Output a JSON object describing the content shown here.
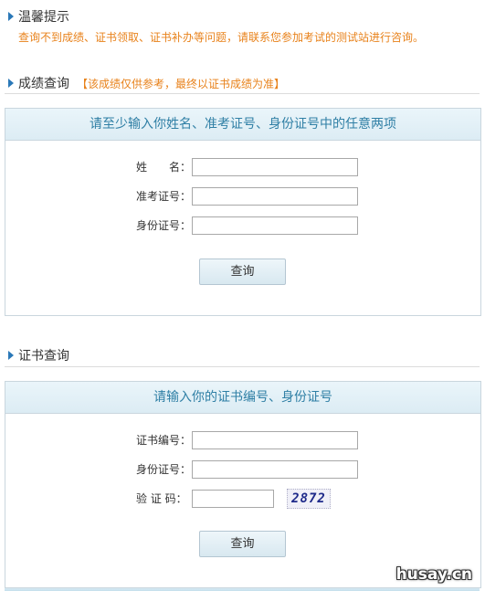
{
  "tip": {
    "title": "温馨提示",
    "text": "查询不到成绩、证书领取、证书补办等问题，请联系您参加考试的测试站进行咨询。"
  },
  "score": {
    "title": "成绩查询",
    "note": "【该成绩仅供参考，最终以证书成绩为准】",
    "panel_title": "请至少输入你姓名、准考证号、身份证号中的任意两项",
    "name_label": "姓　　名：",
    "ticket_label": "准考证号：",
    "id_label": "身份证号：",
    "name_value": "",
    "ticket_value": "",
    "id_value": "",
    "button": "查询"
  },
  "cert": {
    "title": "证书查询",
    "panel_title": "请输入你的证书编号、身份证号",
    "cert_label": "证书编号：",
    "id_label": "身份证号：",
    "captcha_label": "验 证 码：",
    "cert_value": "",
    "id_value": "",
    "captcha_value": "",
    "captcha_text": "2872",
    "button": "查询"
  },
  "watermark": "husay.cn",
  "colors": {
    "accent": "#2a78b8",
    "notice": "#e8821b",
    "panel_title": "#2f7fa5"
  }
}
